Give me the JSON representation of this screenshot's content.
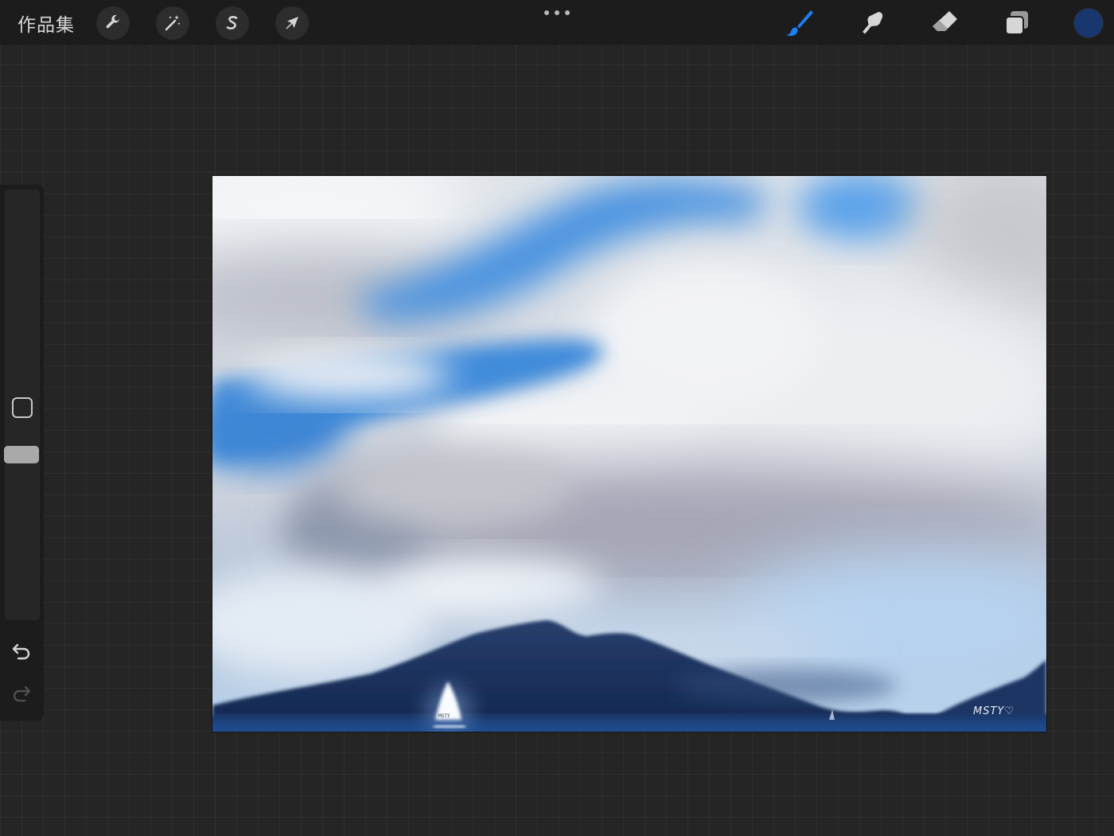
{
  "topbar": {
    "gallery_label": "作品集",
    "left_tools": [
      {
        "name": "actions",
        "icon": "wrench-icon"
      },
      {
        "name": "adjustments",
        "icon": "magic-wand-icon"
      },
      {
        "name": "selection",
        "icon": "selection-s-icon"
      },
      {
        "name": "transform",
        "icon": "arrow-cursor-icon"
      }
    ],
    "right_tools": [
      {
        "name": "brush",
        "icon": "brush-icon",
        "active": true
      },
      {
        "name": "smudge",
        "icon": "smudge-finger-icon",
        "active": false
      },
      {
        "name": "eraser",
        "icon": "eraser-icon",
        "active": false
      },
      {
        "name": "layers",
        "icon": "layers-icon",
        "active": false
      }
    ],
    "active_color": "#17376e",
    "accent_color": "#1c7ef0"
  },
  "sidebar": {
    "brush_size_level": 0.38,
    "opacity_level": 0.62
  },
  "canvas": {
    "signature_text": "MSTY♡",
    "boat_text": "MSTY"
  }
}
